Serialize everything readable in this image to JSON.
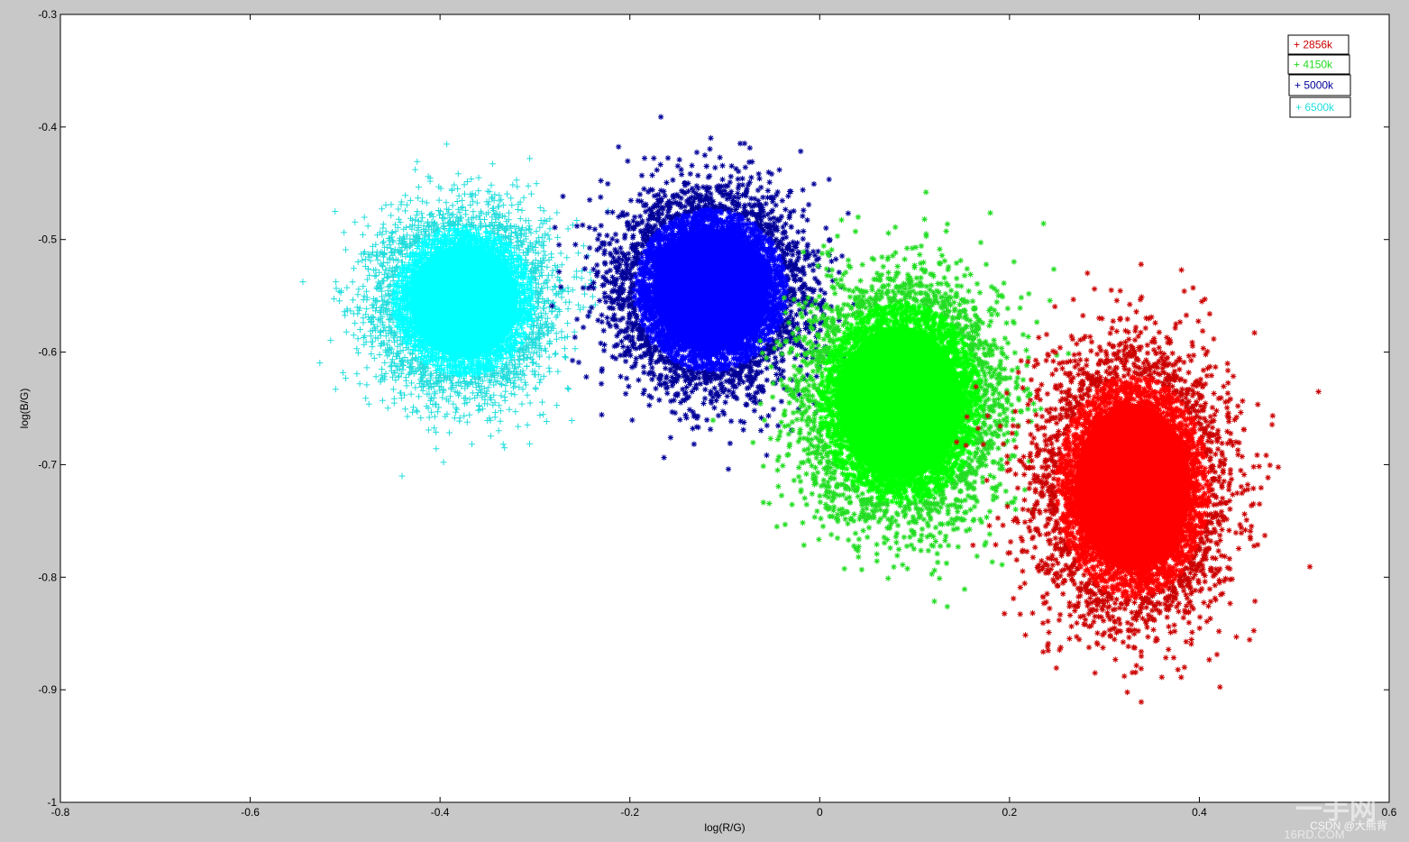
{
  "chart_data": {
    "type": "scatter",
    "title": "",
    "xlabel": "log(R/G)",
    "ylabel": "log(B/G)",
    "xlim": [
      -0.8,
      0.6
    ],
    "ylim": [
      -1.0,
      -0.3
    ],
    "grid": false,
    "legend_position": "top-right",
    "xticks": [
      -0.8,
      -0.6,
      -0.4,
      -0.2,
      0,
      0.2,
      0.4,
      0.6
    ],
    "yticks": [
      -0.3,
      -0.4,
      -0.5,
      -0.6,
      -0.7,
      -0.8,
      -0.9,
      -1
    ],
    "xtick_labels": [
      "-0.8",
      "-0.6",
      "-0.4",
      "-0.2",
      "0",
      "0.2",
      "0.4",
      "0.6"
    ],
    "ytick_labels": [
      "-0.3",
      "-0.4",
      "-0.5",
      "-0.6",
      "-0.7",
      "-0.8",
      "-0.9",
      "-1"
    ],
    "series": [
      {
        "name": "2856k",
        "marker": "*",
        "color": "#ff0000",
        "edge_color": "#cc0000",
        "center": [
          0.33,
          -0.72
        ],
        "spread": [
          0.045,
          0.055
        ],
        "points_approx": 7000
      },
      {
        "name": "4150k",
        "marker": "*",
        "color": "#00ff00",
        "edge_color": "#22dd22",
        "center": [
          0.085,
          -0.645
        ],
        "spread": [
          0.048,
          0.05
        ],
        "points_approx": 7000
      },
      {
        "name": "5000k",
        "marker": "*",
        "color": "#0000ff",
        "edge_color": "#000099",
        "center": [
          -0.115,
          -0.545
        ],
        "spread": [
          0.045,
          0.04
        ],
        "points_approx": 7000
      },
      {
        "name": "6500k",
        "marker": "+",
        "color": "#00ffff",
        "edge_color": "#22dddd",
        "center": [
          -0.375,
          -0.555
        ],
        "spread": [
          0.042,
          0.037
        ],
        "points_approx": 7000
      }
    ]
  },
  "legend": {
    "items": [
      {
        "label": "2856k",
        "symbol": "+",
        "color": "#cc0000"
      },
      {
        "label": "4150k",
        "symbol": "+",
        "color": "#22dd22"
      },
      {
        "label": "5000k",
        "symbol": "+",
        "color": "#000099"
      },
      {
        "label": "6500k",
        "symbol": "+",
        "color": "#22dddd"
      }
    ]
  },
  "watermark": {
    "text": "CSDN @大熊背",
    "logo_text": "一手网",
    "logo_sub": "16RD.COM"
  }
}
